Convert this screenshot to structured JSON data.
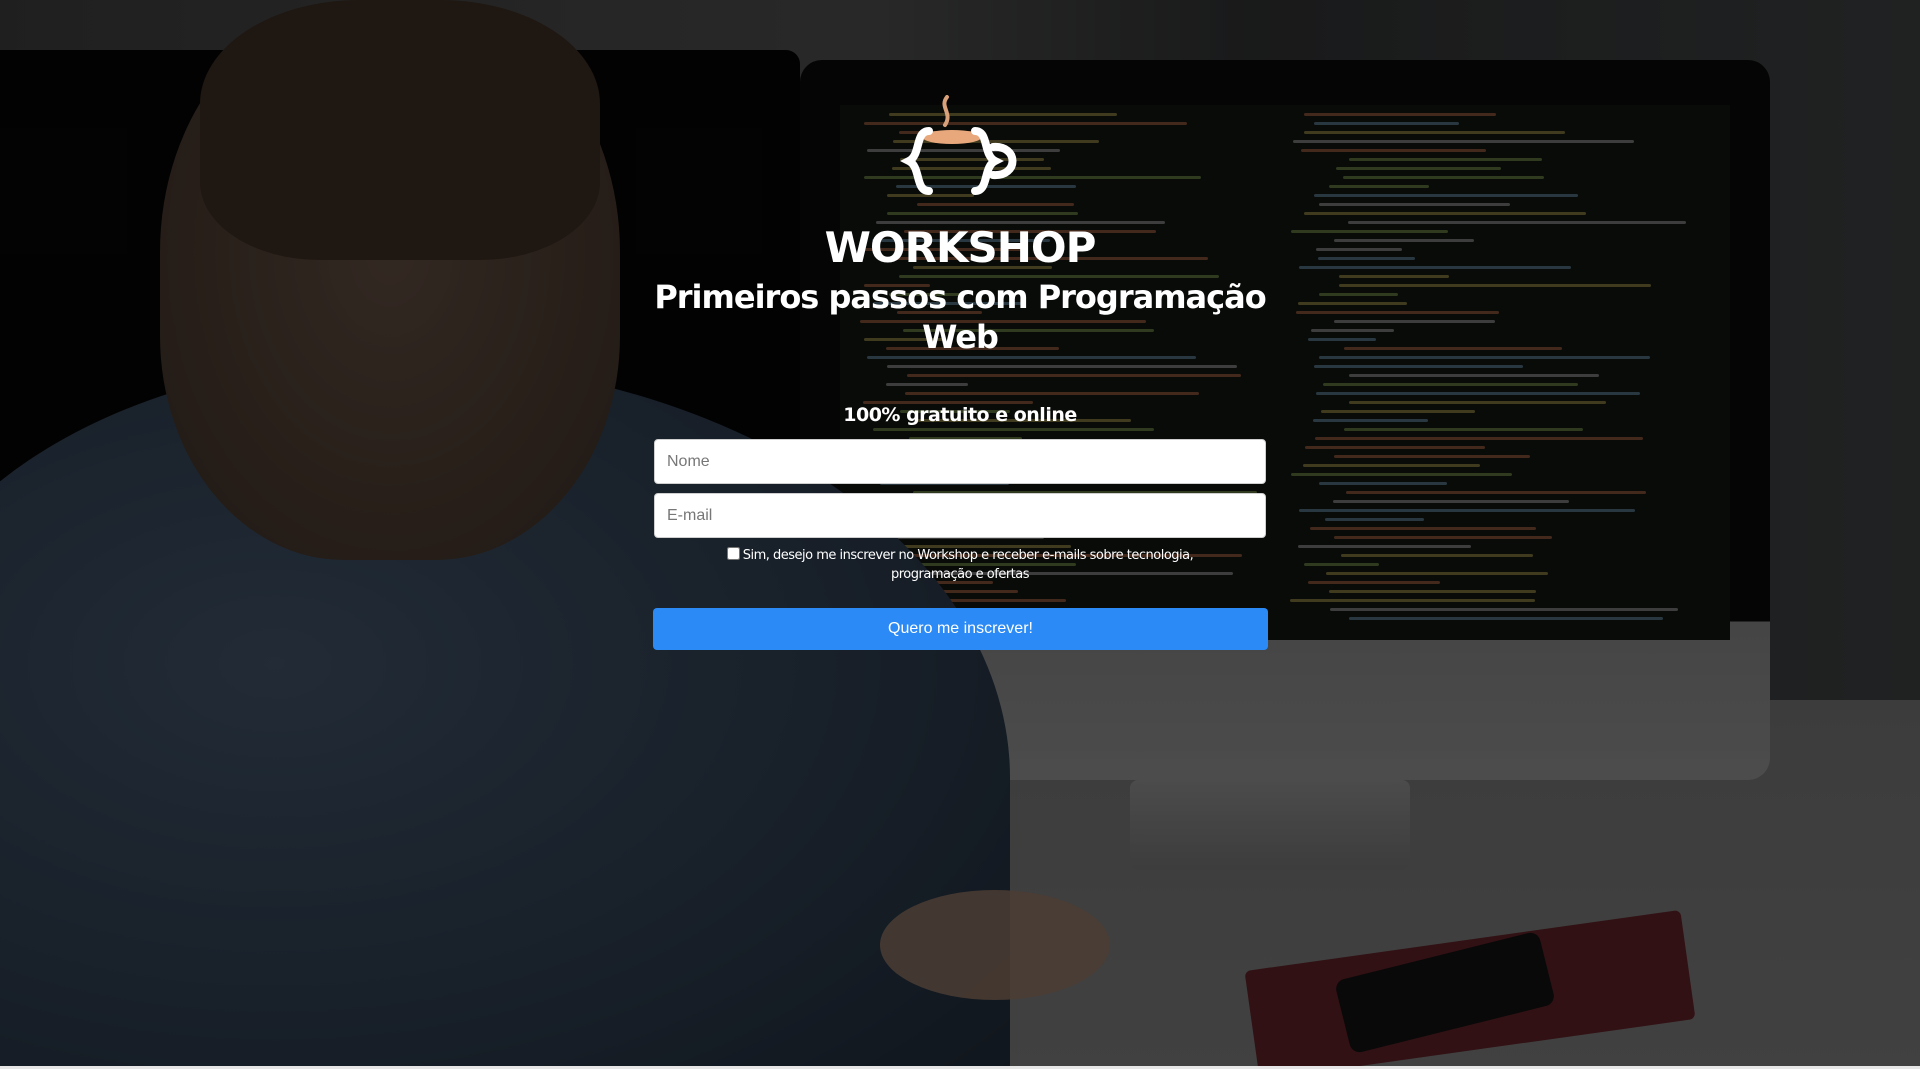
{
  "brand": {
    "logo_icon": "coffee-mug-braces-icon",
    "accent_color": "#2b8af5",
    "logo_cup_color": "#e8a87c"
  },
  "hero": {
    "title": "WORKSHOP",
    "subtitle": "Primeiros passos com Programação Web",
    "tagline": "100% gratuito e online"
  },
  "form": {
    "name_placeholder": "Nome",
    "email_placeholder": "E-mail",
    "consent_checked": false,
    "consent_line1": "Sim, desejo me inscrever no Workshop e receber e-mails sobre tecnologia,",
    "consent_line2": "programação e ofertas",
    "submit_label": "Quero me inscrever!"
  }
}
